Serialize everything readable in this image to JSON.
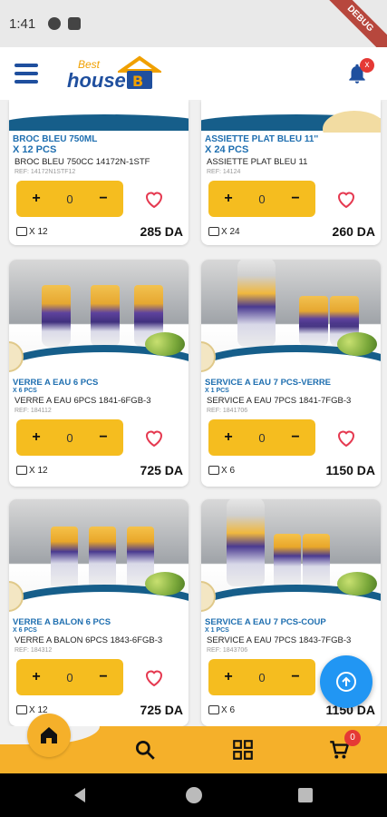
{
  "status_bar": {
    "time": "1:41",
    "debug_label": "DEBUG"
  },
  "header": {
    "logo_best": "Best",
    "logo_house": "house",
    "notification_badge": "x"
  },
  "products": [
    {
      "category": "BROC BLEU 750ML",
      "pack_label": "X 12 PCS",
      "name": "BROC BLEU 750CC  14172N-1STF",
      "ref": "REF: 14172N1STF12",
      "qty": "0",
      "pack_count": "X 12",
      "price": "285 DA"
    },
    {
      "category": "ASSIETTE PLAT BLEU  11''",
      "pack_label": "X 24 PCS",
      "name": "ASSIETTE PLAT BLEU  11",
      "ref": "REF: 14124",
      "qty": "0",
      "pack_count": "X 24",
      "price": "260 DA"
    },
    {
      "category": "VERRE A EAU 6 PCS",
      "pack_label": "X 6 PCS",
      "name": "VERRE A EAU 6PCS   1841-6FGB-3",
      "ref": "REF: 184112",
      "qty": "0",
      "pack_count": "X 12",
      "price": "725 DA"
    },
    {
      "category": "SERVICE A EAU 7 PCS-VERRE",
      "pack_label": "X 1 PCS",
      "name": "SERVICE A EAU 7PCS   1841-7FGB-3",
      "ref": "REF: 1841706",
      "qty": "0",
      "pack_count": "X 6",
      "price": "1150 DA"
    },
    {
      "category": "VERRE A BALON 6 PCS",
      "pack_label": "X 6 PCS",
      "name": "VERRE A BALON 6PCS 1843-6FGB-3",
      "ref": "REF: 184312",
      "qty": "0",
      "pack_count": "X 12",
      "price": "725 DA"
    },
    {
      "category": "SERVICE A EAU 7 PCS-COUP",
      "pack_label": "X 1 PCS",
      "name": "SERVICE A EAU 7PCS   1843-7FGB-3",
      "ref": "REF: 1843706",
      "qty": "0",
      "pack_count": "X 6",
      "price": "1150 DA"
    }
  ],
  "stepper": {
    "minus": "−",
    "plus": "+"
  },
  "bottom_nav": {
    "cart_badge": "0"
  },
  "colors": {
    "accent": "#f5b02a",
    "stepper": "#f5bd1f",
    "brand_blue": "#1f4f9e",
    "fab": "#2196f3",
    "heart": "#e53950"
  },
  "icons": [
    "menu-icon",
    "bell-icon",
    "heart-icon",
    "package-icon",
    "arrow-up-icon",
    "home-icon",
    "search-icon",
    "grid-icon",
    "cart-icon"
  ]
}
